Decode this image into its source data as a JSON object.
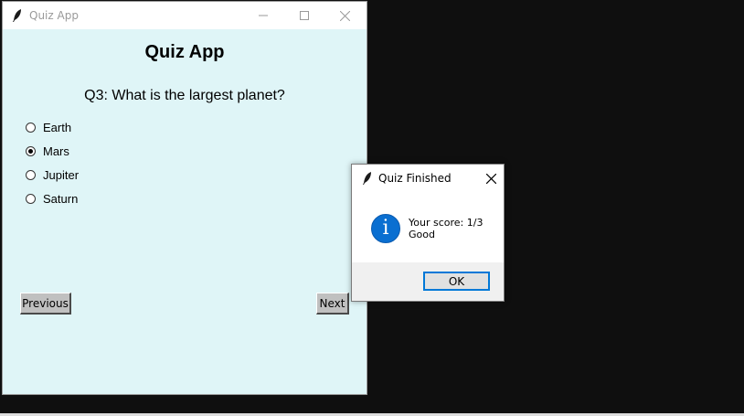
{
  "main_window": {
    "title": "Quiz App",
    "heading": "Quiz App",
    "question": "Q3: What is the largest planet?",
    "options": [
      {
        "label": "Earth",
        "selected": false
      },
      {
        "label": "Mars",
        "selected": true
      },
      {
        "label": "Jupiter",
        "selected": false
      },
      {
        "label": "Saturn",
        "selected": false
      }
    ],
    "buttons": {
      "previous": "Previous",
      "next": "Next"
    },
    "icons": {
      "app": "feather-icon",
      "minimize": "minimize-icon",
      "maximize": "maximize-icon",
      "close": "close-icon"
    }
  },
  "dialog": {
    "title": "Quiz Finished",
    "message_lines": [
      "Your score: 1/3",
      "Good"
    ],
    "ok_label": "OK",
    "icons": {
      "app": "feather-icon",
      "info": "info-icon",
      "close": "close-icon"
    }
  },
  "colors": {
    "window_bg": "#dff5f7",
    "desktop_bg": "#0f0f0f",
    "info_blue": "#0a6fd1",
    "focus_blue": "#0078d7"
  }
}
